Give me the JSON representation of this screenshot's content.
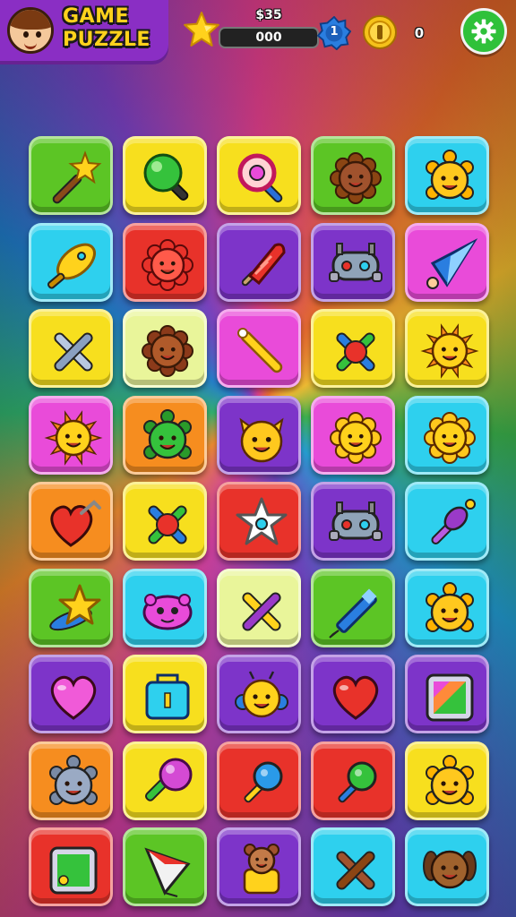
{
  "header": {
    "title": "GAME PUZZLE",
    "coins": "$35",
    "score": "000",
    "level": "1",
    "gems": "0"
  },
  "icons": {
    "avatar": "player-avatar",
    "star": "star-icon",
    "level": "level-badge-icon",
    "coin": "gold-coin-icon",
    "settings": "gear-icon"
  },
  "colors": {
    "green": "#5cc525",
    "yellow": "#f7df1e",
    "cyan": "#2ed0ee",
    "red": "#e8322a",
    "purple": "#7d34c9",
    "pink": "#e94bd9",
    "lime": "#e9f59a",
    "orange": "#f68d1f"
  },
  "board": {
    "rows": [
      [
        {
          "color": "green",
          "icon": "wand"
        },
        {
          "color": "yellow",
          "icon": "green-lollipop"
        },
        {
          "color": "yellow",
          "icon": "magnifier"
        },
        {
          "color": "green",
          "icon": "brown-creature"
        },
        {
          "color": "cyan",
          "icon": "yellow-turtle"
        }
      ],
      [
        {
          "color": "cyan",
          "icon": "yellow-rocket"
        },
        {
          "color": "red",
          "icon": "red-crab"
        },
        {
          "color": "purple",
          "icon": "popsicle"
        },
        {
          "color": "purple",
          "icon": "gray-robot"
        },
        {
          "color": "pink",
          "icon": "blue-cone"
        }
      ],
      [
        {
          "color": "yellow",
          "icon": "cross-wrench"
        },
        {
          "color": "lime",
          "icon": "brown-flower-face"
        },
        {
          "color": "pink",
          "icon": "golden-wand"
        },
        {
          "color": "yellow",
          "icon": "cross-ball"
        },
        {
          "color": "yellow",
          "icon": "sun-face"
        }
      ],
      [
        {
          "color": "pink",
          "icon": "sun-face"
        },
        {
          "color": "orange",
          "icon": "green-turtle"
        },
        {
          "color": "purple",
          "icon": "cat-face"
        },
        {
          "color": "pink",
          "icon": "yellow-flower-face"
        },
        {
          "color": "cyan",
          "icon": "yellow-flower-face"
        }
      ],
      [
        {
          "color": "orange",
          "icon": "heart-hook"
        },
        {
          "color": "yellow",
          "icon": "cross-ball"
        },
        {
          "color": "red",
          "icon": "white-star"
        },
        {
          "color": "purple",
          "icon": "gray-robot"
        },
        {
          "color": "cyan",
          "icon": "purple-sword"
        }
      ],
      [
        {
          "color": "green",
          "icon": "yellow-star"
        },
        {
          "color": "cyan",
          "icon": "pink-blob"
        },
        {
          "color": "lime",
          "icon": "yellow-cross"
        },
        {
          "color": "green",
          "icon": "blue-pencil"
        },
        {
          "color": "cyan",
          "icon": "yellow-turtle"
        }
      ],
      [
        {
          "color": "purple",
          "icon": "pink-heart"
        },
        {
          "color": "yellow",
          "icon": "blue-box"
        },
        {
          "color": "purple",
          "icon": "yellow-bug"
        },
        {
          "color": "purple",
          "icon": "red-heart"
        },
        {
          "color": "purple",
          "icon": "rainbow-card"
        }
      ],
      [
        {
          "color": "orange",
          "icon": "gray-turtle"
        },
        {
          "color": "yellow",
          "icon": "pink-lollipop"
        },
        {
          "color": "red",
          "icon": "blue-pin"
        },
        {
          "color": "red",
          "icon": "green-pin"
        },
        {
          "color": "yellow",
          "icon": "yellow-turtle"
        }
      ],
      [
        {
          "color": "red",
          "icon": "green-card"
        },
        {
          "color": "green",
          "icon": "kite"
        },
        {
          "color": "purple",
          "icon": "bear-shirt"
        },
        {
          "color": "cyan",
          "icon": "cross-sticks"
        },
        {
          "color": "cyan",
          "icon": "brown-dog"
        }
      ]
    ]
  }
}
